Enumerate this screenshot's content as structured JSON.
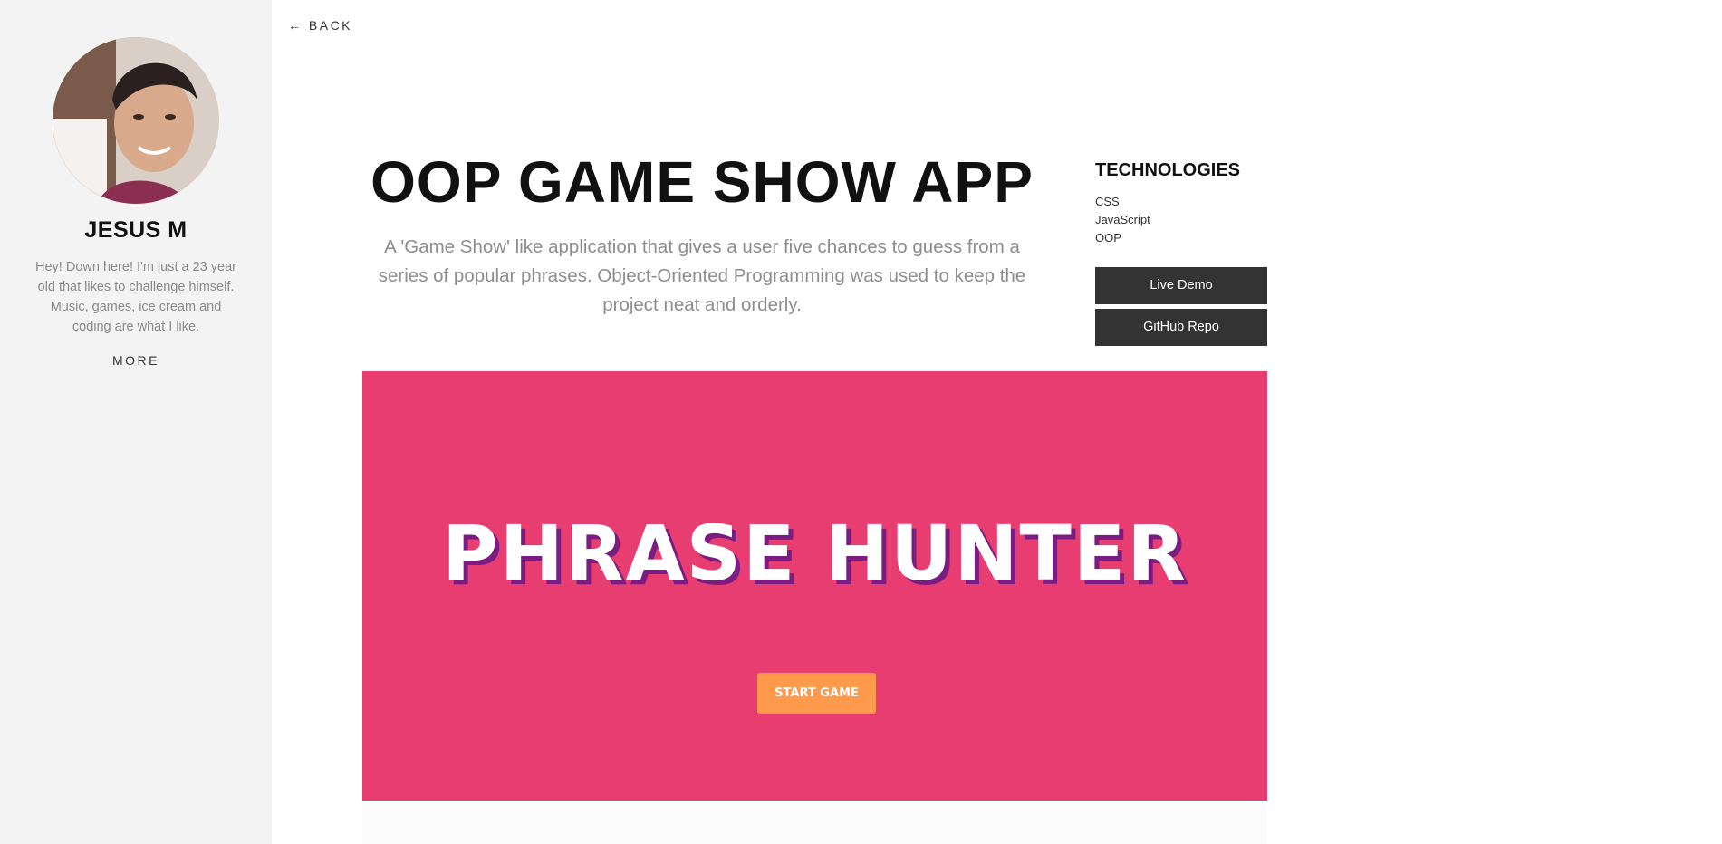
{
  "sidebar": {
    "avatar_icon": "user-photo",
    "name": "JESUS M",
    "bio": "Hey! Down here! I'm just a 23 year old that likes to challenge himself. Music, games, ice cream and coding are what I like.",
    "more_label": "MORE"
  },
  "nav": {
    "back_label": "← BACK"
  },
  "project": {
    "title": "OOP GAME SHOW APP",
    "description": "A 'Game Show' like application that gives a user five chances to guess from a series of popular phrases. Object-Oriented Programming was used to keep the project neat and orderly."
  },
  "technologies": {
    "title": "TECHNOLOGIES",
    "items": [
      "CSS",
      "JavaScript",
      "OOP"
    ]
  },
  "buttons": {
    "live_demo": "Live Demo",
    "github_repo": "GitHub Repo"
  },
  "preview": {
    "heading": "PHRASE HUNTER",
    "start_label": "START GAME"
  },
  "colors": {
    "preview_bg": "#e83d70",
    "start_button": "#ff9a4d",
    "heading_shadow": "#7a1c82",
    "button_dark": "#333333",
    "sidebar_bg": "#f3f3f3"
  }
}
